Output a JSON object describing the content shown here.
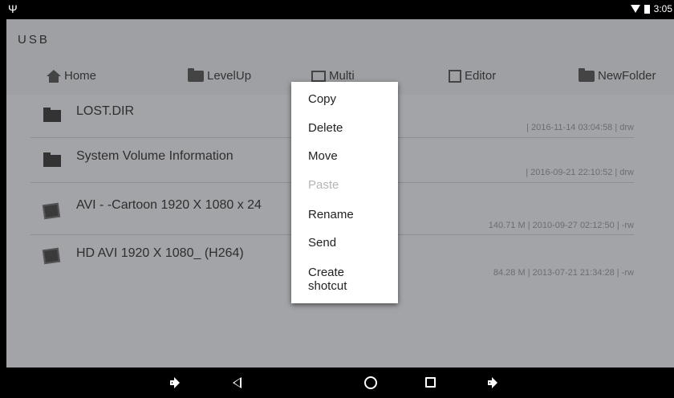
{
  "status_bar": {
    "time": "3:05",
    "usb_symbol": "Ψ"
  },
  "title": "USB",
  "toolbar": [
    {
      "label": "Home",
      "icon": "home-icon"
    },
    {
      "label": "LevelUp",
      "icon": "folder-up-icon"
    },
    {
      "label": "Multi",
      "icon": "multi-select-icon"
    },
    {
      "label": "Editor",
      "icon": "edit-icon"
    },
    {
      "label": "NewFolder",
      "icon": "new-folder-icon"
    }
  ],
  "files": [
    {
      "name": "LOST.DIR",
      "meta": "| 2016-11-14 03:04:58 | drw",
      "icon": "folder-icon"
    },
    {
      "name": "System Volume Information",
      "meta": "| 2016-09-21 22:10:52 | drw",
      "icon": "folder-icon"
    },
    {
      "name": "AVI - -Cartoon 1920 X 1080 x 24",
      "meta": "140.71 M | 2010-09-27 02:12:50 | -rw",
      "icon": "video-file-icon"
    },
    {
      "name": "HD AVI   1920 X 1080_  (H264)",
      "meta": "84.28 M | 2013-07-21 21:34:28 | -rw",
      "icon": "video-file-icon"
    }
  ],
  "context_menu": {
    "copy": "Copy",
    "delete": "Delete",
    "move": "Move",
    "paste": "Paste",
    "rename": "Rename",
    "send": "Send",
    "create_shortcut_line1": "Create",
    "create_shortcut_line2": "shotcut"
  },
  "colors": {
    "dim_overlay_bg": "#a3a4a7",
    "menu_bg": "#ffffff",
    "disabled_text": "#b5b5b5"
  }
}
